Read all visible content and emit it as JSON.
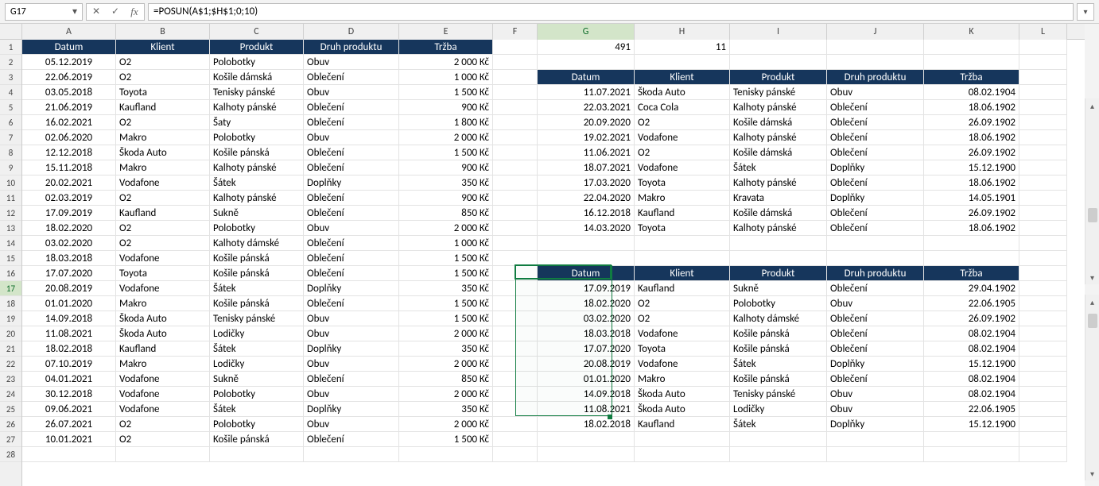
{
  "formula_bar": {
    "cell_ref": "G17",
    "formula": "=POSUN(A$1;$H$1;0;10)"
  },
  "columns": [
    "A",
    "B",
    "C",
    "D",
    "E",
    "F",
    "G",
    "H",
    "I",
    "J",
    "K",
    "L"
  ],
  "col_widths": {
    "A": 118,
    "B": 118,
    "C": 118,
    "D": 120,
    "E": 118,
    "F": 56,
    "G": 122,
    "H": 120,
    "I": 122,
    "J": 122,
    "K": 120,
    "L": 60
  },
  "active_col": "G",
  "active_row": 17,
  "selection": {
    "col": "G",
    "row_start": 17,
    "row_end": 26
  },
  "row_count": 28,
  "left_headers": [
    "Datum",
    "Klient",
    "Produkt",
    "Druh produktu",
    "Tržba"
  ],
  "left_rows": [
    [
      "05.12.2019",
      "O2",
      "Polobotky",
      "Obuv",
      "2 000 Kč"
    ],
    [
      "22.06.2019",
      "O2",
      "Košile dámská",
      "Oblečení",
      "1 000 Kč"
    ],
    [
      "03.05.2018",
      "Toyota",
      "Tenisky pánské",
      "Obuv",
      "1 500 Kč"
    ],
    [
      "21.06.2019",
      "Kaufland",
      "Kalhoty pánské",
      "Oblečení",
      "900 Kč"
    ],
    [
      "16.02.2021",
      "O2",
      "Šaty",
      "Oblečení",
      "1 800 Kč"
    ],
    [
      "02.06.2020",
      "Makro",
      "Polobotky",
      "Obuv",
      "2 000 Kč"
    ],
    [
      "12.12.2018",
      "Škoda Auto",
      "Košile pánská",
      "Oblečení",
      "1 500 Kč"
    ],
    [
      "15.11.2018",
      "Makro",
      "Kalhoty pánské",
      "Oblečení",
      "900 Kč"
    ],
    [
      "20.02.2021",
      "Vodafone",
      "Šátek",
      "Doplňky",
      "350 Kč"
    ],
    [
      "02.03.2019",
      "O2",
      "Kalhoty pánské",
      "Oblečení",
      "900 Kč"
    ],
    [
      "17.09.2019",
      "Kaufland",
      "Sukně",
      "Oblečení",
      "850 Kč"
    ],
    [
      "18.02.2020",
      "O2",
      "Polobotky",
      "Obuv",
      "2 000 Kč"
    ],
    [
      "03.02.2020",
      "O2",
      "Kalhoty dámské",
      "Oblečení",
      "1 000 Kč"
    ],
    [
      "18.03.2018",
      "Vodafone",
      "Košile pánská",
      "Oblečení",
      "1 500 Kč"
    ],
    [
      "17.07.2020",
      "Toyota",
      "Košile pánská",
      "Oblečení",
      "1 500 Kč"
    ],
    [
      "20.08.2019",
      "Vodafone",
      "Šátek",
      "Doplňky",
      "350 Kč"
    ],
    [
      "01.01.2020",
      "Makro",
      "Košile pánská",
      "Oblečení",
      "1 500 Kč"
    ],
    [
      "14.09.2018",
      "Škoda Auto",
      "Tenisky pánské",
      "Obuv",
      "1 500 Kč"
    ],
    [
      "11.08.2021",
      "Škoda Auto",
      "Lodičky",
      "Obuv",
      "2 000 Kč"
    ],
    [
      "18.02.2018",
      "Kaufland",
      "Šátek",
      "Doplňky",
      "350 Kč"
    ],
    [
      "07.10.2019",
      "Makro",
      "Lodičky",
      "Obuv",
      "2 000 Kč"
    ],
    [
      "04.01.2021",
      "Vodafone",
      "Sukně",
      "Oblečení",
      "850 Kč"
    ],
    [
      "30.12.2018",
      "Vodafone",
      "Polobotky",
      "Obuv",
      "2 000 Kč"
    ],
    [
      "09.06.2021",
      "Vodafone",
      "Šátek",
      "Doplňky",
      "350 Kč"
    ],
    [
      "26.07.2021",
      "O2",
      "Polobotky",
      "Obuv",
      "2 000 Kč"
    ],
    [
      "10.01.2021",
      "O2",
      "Košile pánská",
      "Oblečení",
      "1 500 Kč"
    ]
  ],
  "g1": "491",
  "h1": "11",
  "right_headers": [
    "Datum",
    "Klient",
    "Produkt",
    "Druh produktu",
    "Tržba"
  ],
  "right_upper_rows": [
    [
      "11.07.2021",
      "Škoda Auto",
      "Tenisky pánské",
      "Obuv",
      "08.02.1904"
    ],
    [
      "22.03.2021",
      "Coca Cola",
      "Kalhoty pánské",
      "Oblečení",
      "18.06.1902"
    ],
    [
      "20.09.2020",
      "O2",
      "Košile dámská",
      "Oblečení",
      "26.09.1902"
    ],
    [
      "19.02.2021",
      "Vodafone",
      "Kalhoty pánské",
      "Oblečení",
      "18.06.1902"
    ],
    [
      "11.06.2021",
      "O2",
      "Košile dámská",
      "Oblečení",
      "26.09.1902"
    ],
    [
      "18.07.2021",
      "Vodafone",
      "Šátek",
      "Doplňky",
      "15.12.1900"
    ],
    [
      "17.03.2020",
      "Toyota",
      "Kalhoty pánské",
      "Oblečení",
      "18.06.1902"
    ],
    [
      "22.04.2020",
      "Makro",
      "Kravata",
      "Doplňky",
      "14.05.1901"
    ],
    [
      "16.12.2018",
      "Kaufland",
      "Košile dámská",
      "Oblečení",
      "26.09.1902"
    ],
    [
      "14.03.2020",
      "Toyota",
      "Kalhoty pánské",
      "Oblečení",
      "18.06.1902"
    ]
  ],
  "right_lower_rows": [
    [
      "17.09.2019",
      "Kaufland",
      "Sukně",
      "Oblečení",
      "29.04.1902"
    ],
    [
      "18.02.2020",
      "O2",
      "Polobotky",
      "Obuv",
      "22.06.1905"
    ],
    [
      "03.02.2020",
      "O2",
      "Kalhoty dámské",
      "Oblečení",
      "26.09.1902"
    ],
    [
      "18.03.2018",
      "Vodafone",
      "Košile pánská",
      "Oblečení",
      "08.02.1904"
    ],
    [
      "17.07.2020",
      "Toyota",
      "Košile pánská",
      "Oblečení",
      "08.02.1904"
    ],
    [
      "20.08.2019",
      "Vodafone",
      "Šátek",
      "Doplňky",
      "15.12.1900"
    ],
    [
      "01.01.2020",
      "Makro",
      "Košile pánská",
      "Oblečení",
      "08.02.1904"
    ],
    [
      "14.09.2018",
      "Škoda Auto",
      "Tenisky pánské",
      "Obuv",
      "08.02.1904"
    ],
    [
      "11.08.2021",
      "Škoda Auto",
      "Lodičky",
      "Obuv",
      "22.06.1905"
    ],
    [
      "18.02.2018",
      "Kaufland",
      "Šátek",
      "Doplňky",
      "15.12.1900"
    ]
  ]
}
